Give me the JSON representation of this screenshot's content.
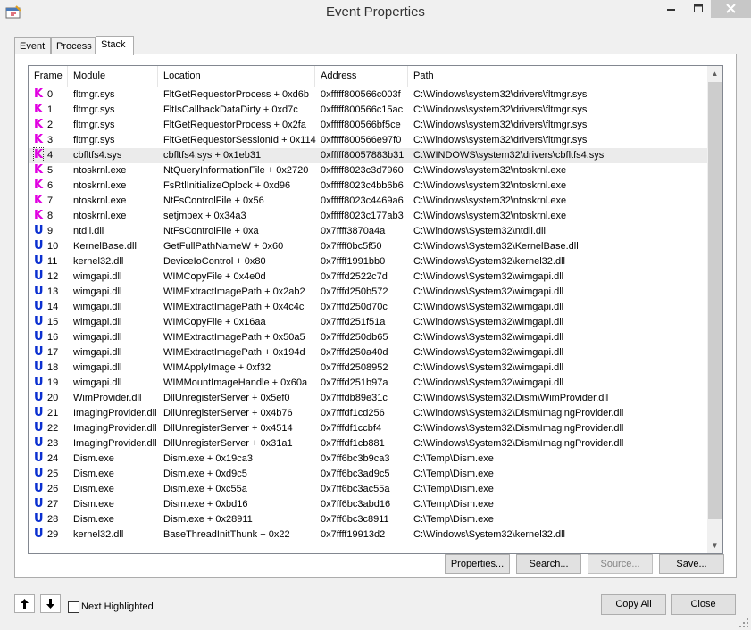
{
  "window": {
    "title": "Event Properties"
  },
  "tabs": [
    {
      "label": "Event"
    },
    {
      "label": "Process"
    },
    {
      "label": "Stack"
    }
  ],
  "columns": {
    "frame": "Frame",
    "module": "Module",
    "location": "Location",
    "address": "Address",
    "path": "Path"
  },
  "rows": [
    {
      "t": "K",
      "frame": "0",
      "module": "fltmgr.sys",
      "location": "FltGetRequestorProcess + 0xd6b",
      "address": "0xfffff800566c003f",
      "path": "C:\\Windows\\system32\\drivers\\fltmgr.sys"
    },
    {
      "t": "K",
      "frame": "1",
      "module": "fltmgr.sys",
      "location": "FltIsCallbackDataDirty + 0xd7c",
      "address": "0xfffff800566c15ac",
      "path": "C:\\Windows\\system32\\drivers\\fltmgr.sys"
    },
    {
      "t": "K",
      "frame": "2",
      "module": "fltmgr.sys",
      "location": "FltGetRequestorProcess + 0x2fa",
      "address": "0xfffff800566bf5ce",
      "path": "C:\\Windows\\system32\\drivers\\fltmgr.sys"
    },
    {
      "t": "K",
      "frame": "3",
      "module": "fltmgr.sys",
      "location": "FltGetRequestorSessionId + 0x114",
      "address": "0xfffff800566e97f0",
      "path": "C:\\Windows\\system32\\drivers\\fltmgr.sys"
    },
    {
      "t": "K",
      "frame": "4",
      "module": "cbfltfs4.sys",
      "location": "cbfltfs4.sys + 0x1eb31",
      "address": "0xfffff80057883b31",
      "path": "C:\\WINDOWS\\system32\\drivers\\cbfltfs4.sys"
    },
    {
      "t": "K",
      "frame": "5",
      "module": "ntoskrnl.exe",
      "location": "NtQueryInformationFile + 0x2720",
      "address": "0xfffff8023c3d7960",
      "path": "C:\\Windows\\system32\\ntoskrnl.exe"
    },
    {
      "t": "K",
      "frame": "6",
      "module": "ntoskrnl.exe",
      "location": "FsRtlInitializeOplock + 0xd96",
      "address": "0xfffff8023c4bb6b6",
      "path": "C:\\Windows\\system32\\ntoskrnl.exe"
    },
    {
      "t": "K",
      "frame": "7",
      "module": "ntoskrnl.exe",
      "location": "NtFsControlFile + 0x56",
      "address": "0xfffff8023c4469a6",
      "path": "C:\\Windows\\system32\\ntoskrnl.exe"
    },
    {
      "t": "K",
      "frame": "8",
      "module": "ntoskrnl.exe",
      "location": "setjmpex + 0x34a3",
      "address": "0xfffff8023c177ab3",
      "path": "C:\\Windows\\system32\\ntoskrnl.exe"
    },
    {
      "t": "U",
      "frame": "9",
      "module": "ntdll.dll",
      "location": "NtFsControlFile + 0xa",
      "address": "0x7ffff3870a4a",
      "path": "C:\\Windows\\System32\\ntdll.dll"
    },
    {
      "t": "U",
      "frame": "10",
      "module": "KernelBase.dll",
      "location": "GetFullPathNameW + 0x60",
      "address": "0x7ffff0bc5f50",
      "path": "C:\\Windows\\System32\\KernelBase.dll"
    },
    {
      "t": "U",
      "frame": "11",
      "module": "kernel32.dll",
      "location": "DeviceIoControl + 0x80",
      "address": "0x7ffff1991bb0",
      "path": "C:\\Windows\\System32\\kernel32.dll"
    },
    {
      "t": "U",
      "frame": "12",
      "module": "wimgapi.dll",
      "location": "WIMCopyFile + 0x4e0d",
      "address": "0x7fffd2522c7d",
      "path": "C:\\Windows\\System32\\wimgapi.dll"
    },
    {
      "t": "U",
      "frame": "13",
      "module": "wimgapi.dll",
      "location": "WIMExtractImagePath + 0x2ab2",
      "address": "0x7fffd250b572",
      "path": "C:\\Windows\\System32\\wimgapi.dll"
    },
    {
      "t": "U",
      "frame": "14",
      "module": "wimgapi.dll",
      "location": "WIMExtractImagePath + 0x4c4c",
      "address": "0x7fffd250d70c",
      "path": "C:\\Windows\\System32\\wimgapi.dll"
    },
    {
      "t": "U",
      "frame": "15",
      "module": "wimgapi.dll",
      "location": "WIMCopyFile + 0x16aa",
      "address": "0x7fffd251f51a",
      "path": "C:\\Windows\\System32\\wimgapi.dll"
    },
    {
      "t": "U",
      "frame": "16",
      "module": "wimgapi.dll",
      "location": "WIMExtractImagePath + 0x50a5",
      "address": "0x7fffd250db65",
      "path": "C:\\Windows\\System32\\wimgapi.dll"
    },
    {
      "t": "U",
      "frame": "17",
      "module": "wimgapi.dll",
      "location": "WIMExtractImagePath + 0x194d",
      "address": "0x7fffd250a40d",
      "path": "C:\\Windows\\System32\\wimgapi.dll"
    },
    {
      "t": "U",
      "frame": "18",
      "module": "wimgapi.dll",
      "location": "WIMApplyImage + 0xf32",
      "address": "0x7fffd2508952",
      "path": "C:\\Windows\\System32\\wimgapi.dll"
    },
    {
      "t": "U",
      "frame": "19",
      "module": "wimgapi.dll",
      "location": "WIMMountImageHandle + 0x60a",
      "address": "0x7fffd251b97a",
      "path": "C:\\Windows\\System32\\wimgapi.dll"
    },
    {
      "t": "U",
      "frame": "20",
      "module": "WimProvider.dll",
      "location": "DllUnregisterServer + 0x5ef0",
      "address": "0x7fffdb89e31c",
      "path": "C:\\Windows\\System32\\Dism\\WimProvider.dll"
    },
    {
      "t": "U",
      "frame": "21",
      "module": "ImagingProvider.dll",
      "location": "DllUnregisterServer + 0x4b76",
      "address": "0x7fffdf1cd256",
      "path": "C:\\Windows\\System32\\Dism\\ImagingProvider.dll"
    },
    {
      "t": "U",
      "frame": "22",
      "module": "ImagingProvider.dll",
      "location": "DllUnregisterServer + 0x4514",
      "address": "0x7fffdf1ccbf4",
      "path": "C:\\Windows\\System32\\Dism\\ImagingProvider.dll"
    },
    {
      "t": "U",
      "frame": "23",
      "module": "ImagingProvider.dll",
      "location": "DllUnregisterServer + 0x31a1",
      "address": "0x7fffdf1cb881",
      "path": "C:\\Windows\\System32\\Dism\\ImagingProvider.dll"
    },
    {
      "t": "U",
      "frame": "24",
      "module": "Dism.exe",
      "location": "Dism.exe + 0x19ca3",
      "address": "0x7ff6bc3b9ca3",
      "path": "C:\\Temp\\Dism.exe"
    },
    {
      "t": "U",
      "frame": "25",
      "module": "Dism.exe",
      "location": "Dism.exe + 0xd9c5",
      "address": "0x7ff6bc3ad9c5",
      "path": "C:\\Temp\\Dism.exe"
    },
    {
      "t": "U",
      "frame": "26",
      "module": "Dism.exe",
      "location": "Dism.exe + 0xc55a",
      "address": "0x7ff6bc3ac55a",
      "path": "C:\\Temp\\Dism.exe"
    },
    {
      "t": "U",
      "frame": "27",
      "module": "Dism.exe",
      "location": "Dism.exe + 0xbd16",
      "address": "0x7ff6bc3abd16",
      "path": "C:\\Temp\\Dism.exe"
    },
    {
      "t": "U",
      "frame": "28",
      "module": "Dism.exe",
      "location": "Dism.exe + 0x28911",
      "address": "0x7ff6bc3c8911",
      "path": "C:\\Temp\\Dism.exe"
    },
    {
      "t": "U",
      "frame": "29",
      "module": "kernel32.dll",
      "location": "BaseThreadInitThunk + 0x22",
      "address": "0x7ffff19913d2",
      "path": "C:\\Windows\\System32\\kernel32.dll"
    }
  ],
  "selected_frame": "4",
  "colors": {
    "kernel": "#e000e0",
    "user": "#0a2fd0"
  },
  "buttons": {
    "properties": "Properties...",
    "search": "Search...",
    "source": "Source...",
    "save": "Save...",
    "copy_all": "Copy All",
    "close": "Close"
  },
  "next_highlighted": {
    "label": "Next Highlighted",
    "checked": false
  }
}
